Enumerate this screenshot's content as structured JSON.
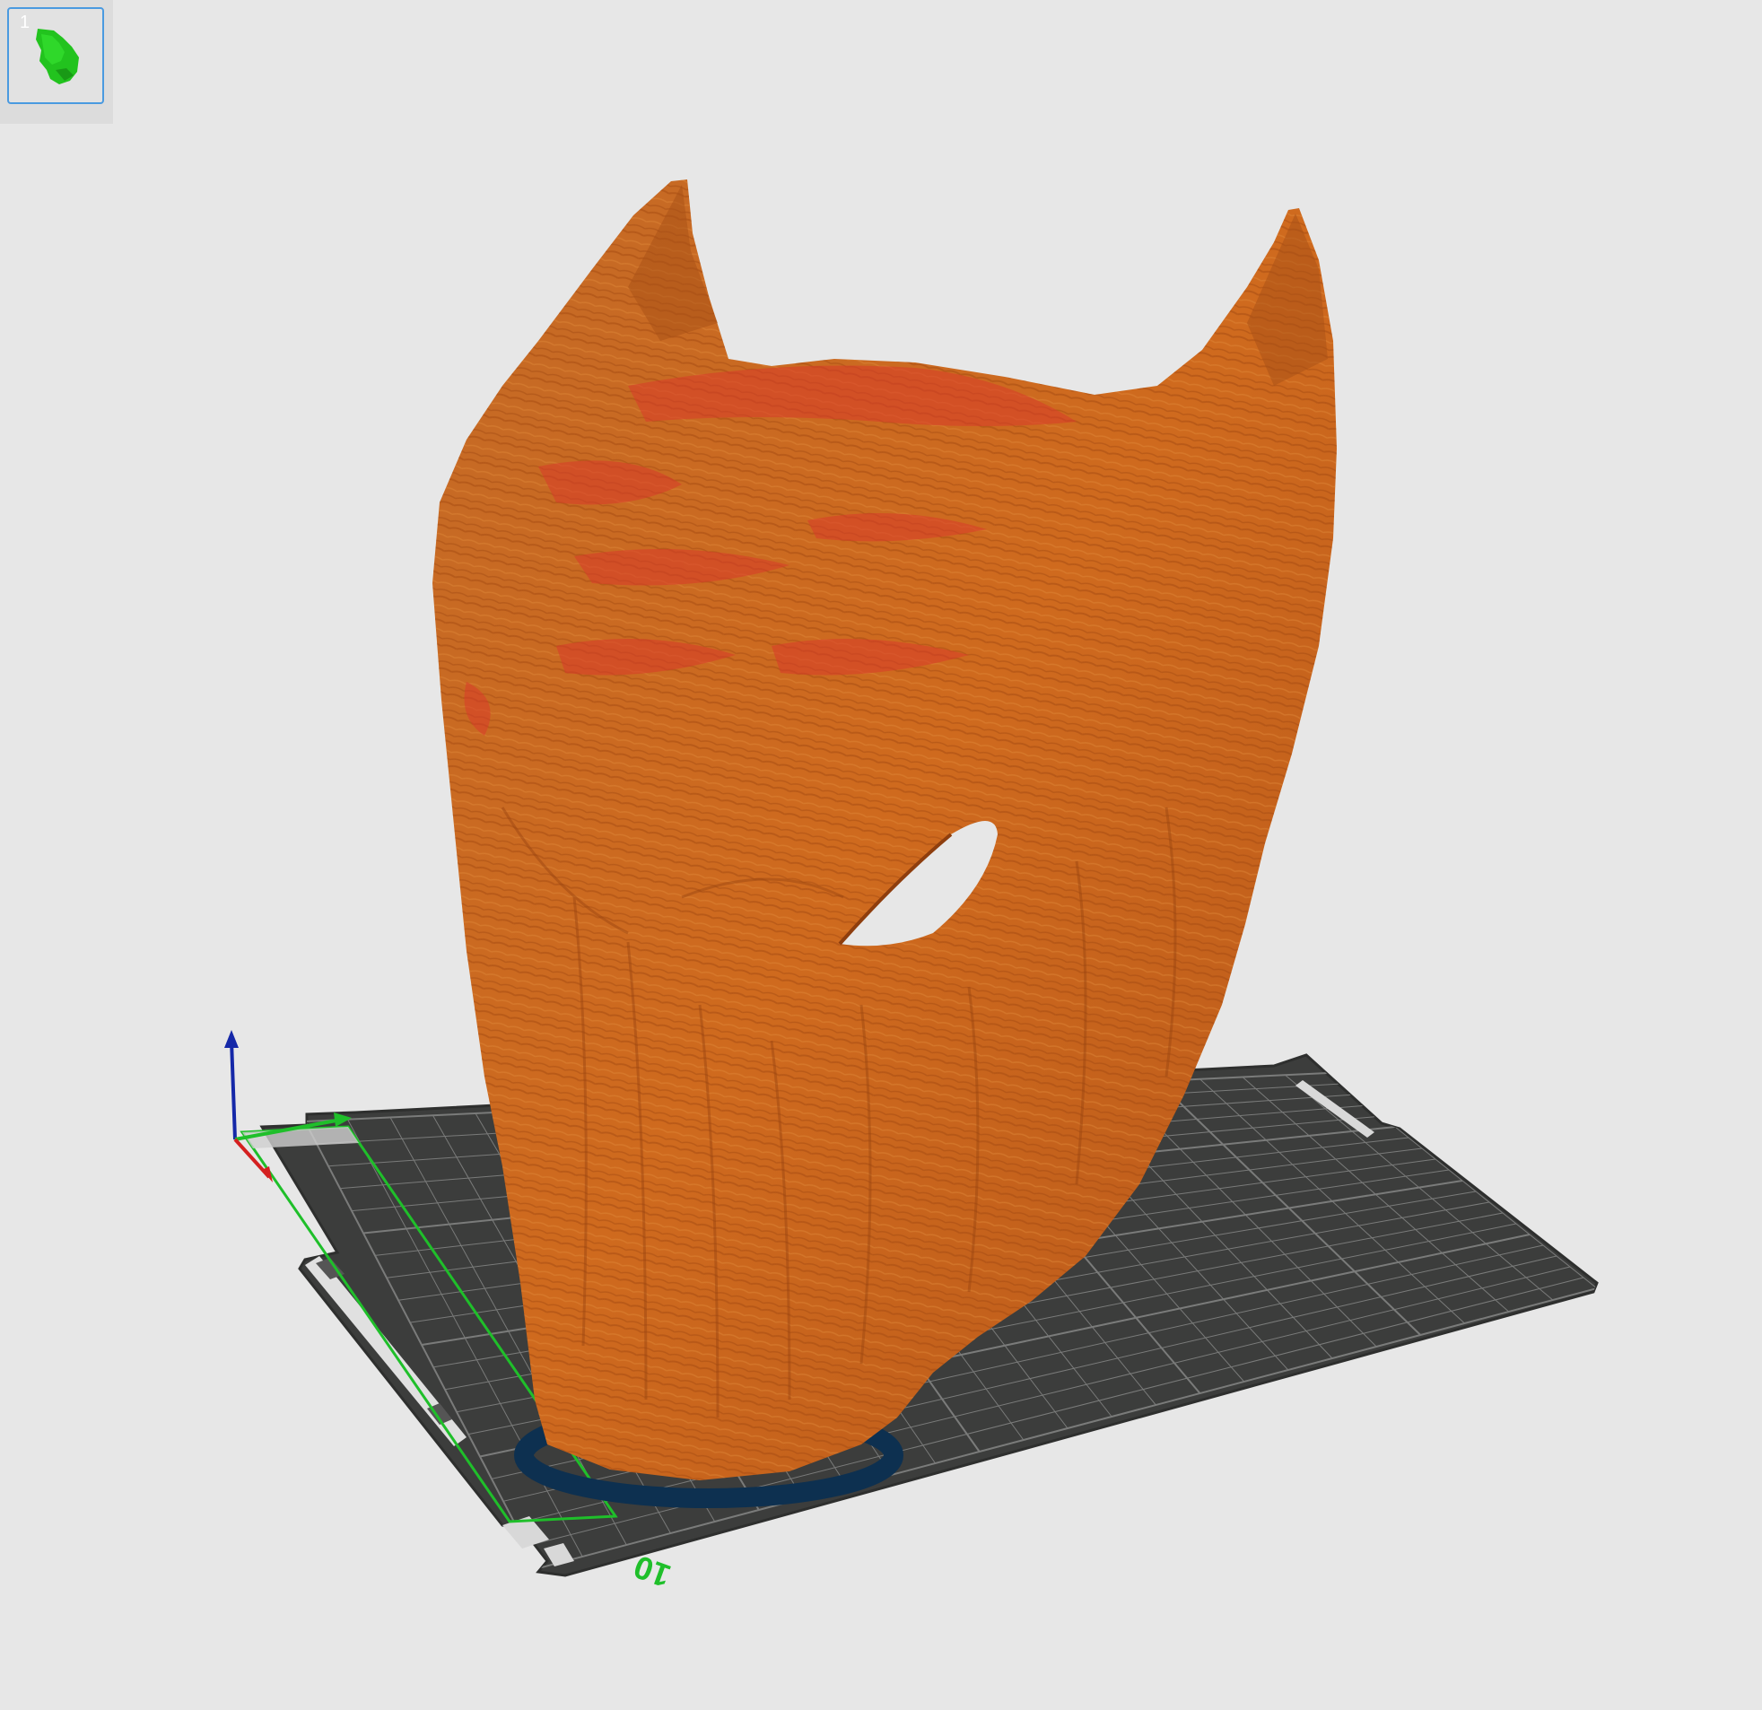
{
  "plate_list": {
    "plates": [
      {
        "index": "1",
        "selected": true,
        "thumbnail_icon": "model-thumbnail-icon",
        "thumbnail_color": "#22c31e"
      }
    ]
  },
  "viewport": {
    "background_color": "#e7e7e7",
    "bed": {
      "surface_color": "#3c3d3c",
      "grid_color": "#7a7b7a",
      "label_text": "10",
      "label_color": "#1fbf2a"
    },
    "model": {
      "preview_color": "#c9621d",
      "highlight_color": "#d93a2a",
      "brim_color": "#0d3050"
    },
    "axes": {
      "x_color": "#d42020",
      "y_color": "#1fbf2a",
      "z_color": "#1528a8"
    }
  }
}
